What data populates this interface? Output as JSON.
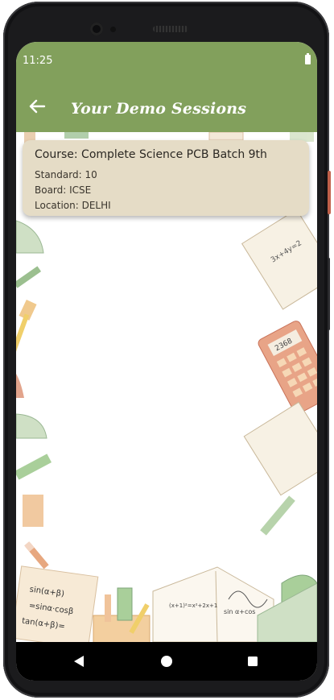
{
  "status_bar": {
    "time": "11:25",
    "battery_icon": "battery-full-icon"
  },
  "app_bar": {
    "title": "Your Demo Sessions",
    "back_icon": "arrow-back-icon"
  },
  "session": {
    "course": "Course: Complete Science PCB Batch 9th",
    "standard": "Standard: 10",
    "board": "Board: ICSE",
    "location": "Location: DELHI"
  },
  "navigation": {
    "back": "back-triangle-icon",
    "home": "home-circle-icon",
    "recents": "recents-square-icon"
  },
  "colors": {
    "app_bar": "#82a05c",
    "card": "#e5dcc6",
    "nav": "#000000"
  },
  "decor_text": {
    "calc_display": "2368",
    "notes_1": "sin(α+β)",
    "notes_2": "=sinα·cosβ",
    "notes_3": "tan(α+β)=",
    "book_1": "sin α+cos",
    "book_2": "(x+1)²=x²+2x+1",
    "sheet": "3x+4y=2"
  }
}
